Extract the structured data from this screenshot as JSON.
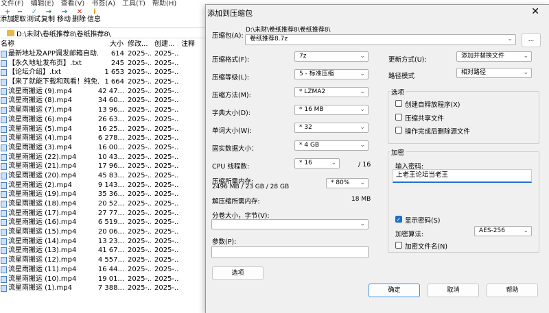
{
  "menu": [
    "文件(F)",
    "编辑(E)",
    "查看(V)",
    "书签(A)",
    "工具(T)",
    "帮助(H)"
  ],
  "toolbar": [
    {
      "label": "添加",
      "icon": "+",
      "color": "#2b9a2b"
    },
    {
      "label": "提取",
      "icon": "−",
      "color": "#1d3fb8"
    },
    {
      "label": "测试",
      "icon": "✓",
      "color": "#3aa0d8"
    },
    {
      "label": "复制",
      "icon": "→",
      "color": "#1b8a3b"
    },
    {
      "label": "移动",
      "icon": "→",
      "color": "#1c6ed8"
    },
    {
      "label": "删除",
      "icon": "✕",
      "color": "#d02020"
    },
    {
      "label": "信息",
      "icon": "i",
      "color": "#c8a000"
    }
  ],
  "address": "D:\\未财\\卷纸推荐8\\卷纸推荐8\\",
  "columns": {
    "name": "名称",
    "size": "大小",
    "modified": "修改...",
    "created": "创建...",
    "comment": "注释"
  },
  "files": [
    {
      "name": "最新地址及APP调发邮箱自动...",
      "size": "614",
      "modified": "2025-...",
      "created": "2025-..."
    },
    {
      "name": "【永久地址发布页】.txt",
      "size": "245",
      "modified": "2025-...",
      "created": "2025-..."
    },
    {
      "name": "【论坛介绍】.txt",
      "size": "1 653",
      "modified": "2025-...",
      "created": "2025-..."
    },
    {
      "name": "【来了就能下载和观看！纯免...",
      "size": "1 664",
      "modified": "2025-...",
      "created": "2025-..."
    },
    {
      "name": "流星雨搬运 (9).mp4",
      "size": "42 47...",
      "modified": "2025-...",
      "created": "2025-..."
    },
    {
      "name": "流星雨搬运 (8).mp4",
      "size": "34 60...",
      "modified": "2025-...",
      "created": "2025-..."
    },
    {
      "name": "流星雨搬运 (7).mp4",
      "size": "13 96...",
      "modified": "2025-...",
      "created": "2025-..."
    },
    {
      "name": "流星雨搬运 (6).mp4",
      "size": "26 63...",
      "modified": "2025-...",
      "created": "2025-..."
    },
    {
      "name": "流星雨搬运 (5).mp4",
      "size": "16 25...",
      "modified": "2025-...",
      "created": "2025-..."
    },
    {
      "name": "流星雨搬运 (4).mp4",
      "size": "6 278...",
      "modified": "2025-...",
      "created": "2025-..."
    },
    {
      "name": "流星雨搬运 (3).mp4",
      "size": "16 00...",
      "modified": "2025-...",
      "created": "2025-..."
    },
    {
      "name": "流星雨搬运 (22).mp4",
      "size": "10 43...",
      "modified": "2025-...",
      "created": "2025-..."
    },
    {
      "name": "流星雨搬运 (21).mp4",
      "size": "17 96...",
      "modified": "2025-...",
      "created": "2025-..."
    },
    {
      "name": "流星雨搬运 (20).mp4",
      "size": "45 83...",
      "modified": "2025-...",
      "created": "2025-..."
    },
    {
      "name": "流星雨搬运 (2).mp4",
      "size": "9 143...",
      "modified": "2025-...",
      "created": "2025-..."
    },
    {
      "name": "流星雨搬运 (19).mp4",
      "size": "35 36...",
      "modified": "2025-...",
      "created": "2025-..."
    },
    {
      "name": "流星雨搬运 (18).mp4",
      "size": "20 52...",
      "modified": "2025-...",
      "created": "2025-..."
    },
    {
      "name": "流星雨搬运 (17).mp4",
      "size": "27 77...",
      "modified": "2025-...",
      "created": "2025-..."
    },
    {
      "name": "流星雨搬运 (16).mp4",
      "size": "6 519...",
      "modified": "2025-...",
      "created": "2025-..."
    },
    {
      "name": "流星雨搬运 (15).mp4",
      "size": "20 06...",
      "modified": "2025-...",
      "created": "2025-..."
    },
    {
      "name": "流星雨搬运 (14).mp4",
      "size": "13 23...",
      "modified": "2025-...",
      "created": "2025-..."
    },
    {
      "name": "流星雨搬运 (13).mp4",
      "size": "41 67...",
      "modified": "2025-...",
      "created": "2025-..."
    },
    {
      "name": "流星雨搬运 (12).mp4",
      "size": "4 557...",
      "modified": "2025-...",
      "created": "2025-..."
    },
    {
      "name": "流星雨搬运 (11).mp4",
      "size": "16 44...",
      "modified": "2025-...",
      "created": "2025-..."
    },
    {
      "name": "流星雨搬运 (10).mp4",
      "size": "19 01...",
      "modified": "2025-...",
      "created": "2025-..."
    },
    {
      "name": "流星雨搬运 (1).mp4",
      "size": "7 388...",
      "modified": "2025-...",
      "created": "2025-..."
    }
  ],
  "dialog": {
    "title": "添加到压缩包",
    "close": "✕",
    "archive_label": "压缩包(A):",
    "archive_path": "D:\\未财\\卷纸推荐8\\卷纸推荐8\\",
    "archive_name": "卷纸推荐8.7z",
    "browse": "...",
    "format_label": "压缩格式(F):",
    "format_value": "7z",
    "level_label": "压缩等级(L):",
    "level_value": "5 - 标准压缩",
    "method_label": "压缩方法(M):",
    "method_value": "*  LZMA2",
    "dict_label": "字典大小(D):",
    "dict_value": "*  16 MB",
    "word_label": "单词大小(W):",
    "word_value": "*  32",
    "solid_label": "固实数据大小：",
    "solid_value": "*  4 GB",
    "cpu_label": "CPU 线程数:",
    "cpu_value": "*  16",
    "cpu_total": "/ 16",
    "mem_comp_label": "压缩所需内存:",
    "mem_comp_value": "2496 MB / 23 GB / 28 GB",
    "mem_percent": "* 80%",
    "mem_decomp_label": "解压缩所需内存:",
    "mem_decomp_value": "18 MB",
    "split_label": "分卷大小，字节(V):",
    "split_value": "",
    "params_label": "参数(P):",
    "params_value": "",
    "options_button": "选项",
    "update_label": "更新方式(U):",
    "update_value": "添加并替换文件",
    "pathmode_label": "路径模式",
    "pathmode_value": "相对路径",
    "options_group": "选项",
    "opt_sfx": "创建自释放程序(X)",
    "opt_shared": "压缩共享文件",
    "opt_delete": "操作完成后删除源文件",
    "encrypt_group": "加密",
    "pw_label": "输入密码:",
    "pw_value": "上老王论坛当老王",
    "show_pw": "显示密码(S)",
    "enc_method_label": "加密算法:",
    "enc_method_value": "AES-256",
    "enc_names": "加密文件名(N)",
    "ok": "确定",
    "cancel": "取消",
    "help": "帮助"
  }
}
